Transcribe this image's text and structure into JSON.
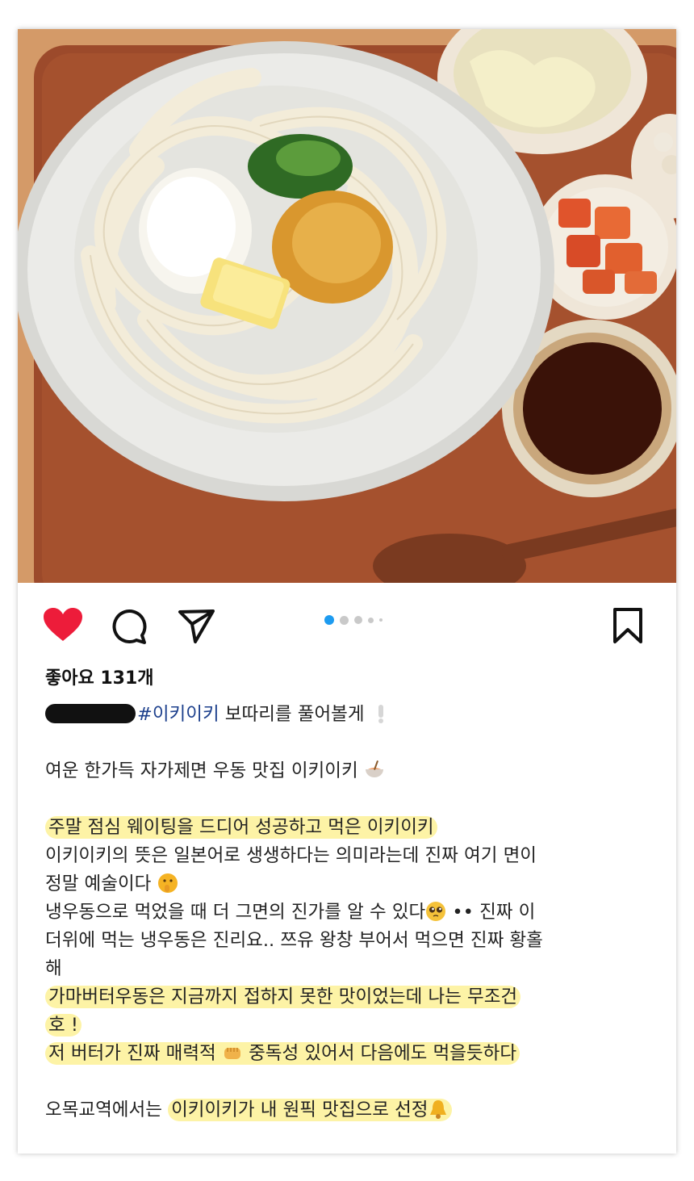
{
  "post": {
    "likes_text": "좋아요 131개",
    "carousel": {
      "total": 5,
      "active_index": 0
    },
    "username_redacted": true,
    "hashtag": "#이키이키",
    "intro_rest": " 보따리를 풀어볼게",
    "lines": {
      "l1": "여운 한가득 자가제면 우동 맛집 이키이키",
      "l2": "주말 점심 웨이팅을 드디어 성공하고 먹은 이키이키",
      "l3": "이키이키의 뜻은 일본어로 생생하다는 의미라는데 진짜 여기 면이",
      "l4": "정말 예술이다",
      "l5a": "냉우동으로 먹었을 때 더 그면의 진가를 알 수 있다",
      "l5b": "•• 진짜 이",
      "l6": "더위에 먹는 냉우동은 진리요.. 쯔유 왕창 부어서 먹으면 진짜 황홀",
      "l7": "해",
      "l8": "가마버터우동은 지금까지 접하지 못한 맛이었는데 나는 무조건",
      "l9": "호 !",
      "l10a": "저 버터가 진짜 매력적",
      "l10b": "중독성 있어서 다음에도 먹을듯하다",
      "l11a": "오목교역에서는 ",
      "l11b": "이키이키가 내 원픽 맛집으로 선정"
    }
  },
  "colors": {
    "heart": "#ed1c3a",
    "highlight": "#fdf3a6",
    "hashtag": "#1c3f8c",
    "carousel_active": "#1d9bf0"
  },
  "icons": [
    "heart-icon",
    "comment-icon",
    "share-icon",
    "bookmark-icon",
    "exclamation-icon",
    "ramen-emoji",
    "shushing-face-emoji",
    "pleading-face-emoji",
    "fist-bump-emoji",
    "bell-emoji"
  ]
}
